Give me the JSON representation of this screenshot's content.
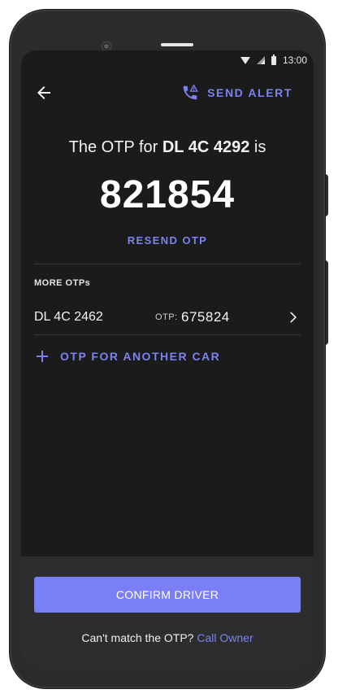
{
  "status_bar": {
    "time": "13:00"
  },
  "header": {
    "send_alert_label": "SEND ALERT"
  },
  "otp": {
    "title_prefix": "The OTP for",
    "vehicle": "DL 4C 4292",
    "title_suffix": "is",
    "code": "821854",
    "resend_label": "RESEND OTP"
  },
  "more_otps": {
    "label": "MORE OTPs",
    "items": [
      {
        "plate": "DL 4C 2462",
        "otp_label": "OTP:",
        "otp": "675824"
      }
    ],
    "add_label": "OTP FOR ANOTHER CAR"
  },
  "footer": {
    "confirm_label": "CONFIRM DRIVER",
    "cant_match_text": "Can't match the OTP?",
    "call_owner_label": "Call Owner"
  },
  "colors": {
    "accent": "#7b7ff5",
    "background": "#1b1b1c",
    "sheet": "#2d2d2e"
  }
}
